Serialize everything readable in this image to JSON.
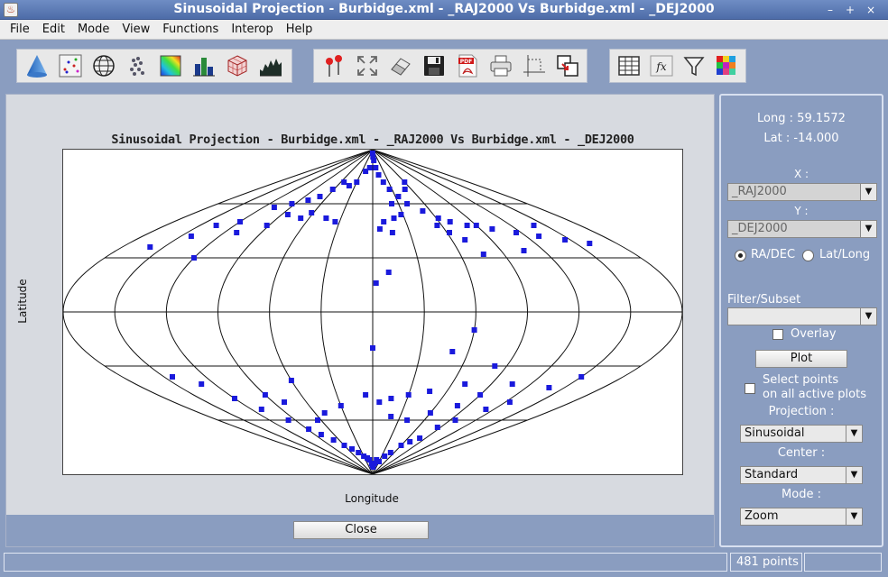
{
  "window": {
    "title": "Sinusoidal Projection - Burbidge.xml - _RAJ2000   Vs  Burbidge.xml - _DEJ2000",
    "controls": [
      "–",
      "+",
      "×"
    ]
  },
  "menu": [
    "File",
    "Edit",
    "Mode",
    "View",
    "Functions",
    "Interop",
    "Help"
  ],
  "toolbar": {
    "group1": [
      "cone-icon",
      "scatter-plot-icon",
      "globe-icon",
      "cluster-icon",
      "color-map-icon",
      "histogram-icon",
      "cube-icon",
      "area-chart-icon"
    ],
    "group2": [
      "pin-icon",
      "fit-zoom-icon",
      "eraser-icon",
      "save-icon",
      "pdf-icon",
      "print-icon",
      "crop-select-icon",
      "export-icon"
    ],
    "group3": [
      "table-icon",
      "function-icon",
      "filter-icon",
      "color-grid-icon"
    ],
    "pdf_badge": "PDF",
    "fx_label": "fx"
  },
  "plot": {
    "title": "Sinusoidal Projection - Burbidge.xml - _RAJ2000   Vs  Burbidge.xml - _DEJ2000",
    "xlabel": "Longitude",
    "ylabel": "Latitude",
    "close_label": "Close",
    "point_color": "#1a1adc",
    "chart_data": {
      "type": "scatter",
      "projection": "sinusoidal",
      "graticule": {
        "latitude_lines_deg": [
          -60,
          -30,
          0,
          30,
          60
        ],
        "meridians_deg": [
          0,
          30,
          60,
          90,
          120,
          150,
          180,
          210,
          240,
          270,
          300,
          330,
          360
        ]
      },
      "points": [
        [
          184,
          -86
        ],
        [
          178,
          -85
        ],
        [
          190,
          -84
        ],
        [
          174,
          -84
        ],
        [
          166,
          -82
        ],
        [
          196,
          -82
        ],
        [
          160,
          -81
        ],
        [
          210,
          -83
        ],
        [
          150,
          -80
        ],
        [
          140,
          -78
        ],
        [
          220,
          -80
        ],
        [
          130,
          -76
        ],
        [
          230,
          -78
        ],
        [
          120,
          -74
        ],
        [
          240,
          -74
        ],
        [
          110,
          -71
        ],
        [
          250,
          -72
        ],
        [
          100,
          -68
        ],
        [
          260,
          -70
        ],
        [
          92,
          -65
        ],
        [
          266,
          -64
        ],
        [
          82,
          -60
        ],
        [
          276,
          -60
        ],
        [
          70,
          -54
        ],
        [
          292,
          -54
        ],
        [
          60,
          -48
        ],
        [
          304,
          -50
        ],
        [
          50,
          -40
        ],
        [
          318,
          -42
        ],
        [
          36,
          -36
        ],
        [
          330,
          -36
        ],
        [
          200,
          -58
        ],
        [
          186,
          -50
        ],
        [
          196,
          -48
        ],
        [
          210,
          -46
        ],
        [
          226,
          -44
        ],
        [
          250,
          -40
        ],
        [
          262,
          -30
        ],
        [
          230,
          -22
        ],
        [
          240,
          -10
        ],
        [
          180,
          -20
        ],
        [
          174,
          -46
        ],
        [
          150,
          -52
        ],
        [
          130,
          -56
        ],
        [
          116,
          -60
        ],
        [
          100,
          -50
        ],
        [
          90,
          -46
        ],
        [
          120,
          -38
        ],
        [
          270,
          -46
        ],
        [
          286,
          -40
        ],
        [
          260,
          -52
        ],
        [
          240,
          -56
        ],
        [
          220,
          -60
        ],
        [
          178,
          88
        ],
        [
          182,
          86
        ],
        [
          186,
          84
        ],
        [
          190,
          80
        ],
        [
          194,
          76
        ],
        [
          200,
          72
        ],
        [
          206,
          68
        ],
        [
          170,
          80
        ],
        [
          160,
          78
        ],
        [
          150,
          72
        ],
        [
          140,
          70
        ],
        [
          126,
          72
        ],
        [
          118,
          68
        ],
        [
          110,
          64
        ],
        [
          100,
          62
        ],
        [
          220,
          60
        ],
        [
          232,
          56
        ],
        [
          242,
          52
        ],
        [
          250,
          50
        ],
        [
          262,
          48
        ],
        [
          270,
          48
        ],
        [
          280,
          46
        ],
        [
          296,
          44
        ],
        [
          310,
          42
        ],
        [
          326,
          40
        ],
        [
          340,
          38
        ],
        [
          86,
          60
        ],
        [
          72,
          58
        ],
        [
          60,
          50
        ],
        [
          44,
          48
        ],
        [
          38,
          42
        ],
        [
          20,
          36
        ],
        [
          200,
          52
        ],
        [
          190,
          50
        ],
        [
          186,
          46
        ],
        [
          146,
          50
        ],
        [
          136,
          52
        ],
        [
          118,
          55
        ],
        [
          112,
          52
        ],
        [
          96,
          54
        ],
        [
          88,
          48
        ],
        [
          70,
          44
        ],
        [
          230,
          68
        ],
        [
          240,
          72
        ],
        [
          250,
          40
        ],
        [
          256,
          32
        ],
        [
          196,
          44
        ],
        [
          190,
          22
        ],
        [
          182,
          16
        ],
        [
          60,
          30
        ],
        [
          202,
          60
        ],
        [
          208,
          54
        ],
        [
          214,
          64
        ],
        [
          236,
          48
        ],
        [
          242,
          44
        ],
        [
          286,
          34
        ],
        [
          320,
          48
        ]
      ],
      "cursor": {
        "long": "59.1572",
        "lat": "-14.000"
      }
    }
  },
  "side": {
    "long_label": "Long :",
    "long_value": "59.1572",
    "lat_label": "Lat   :",
    "lat_value": "-14.000",
    "x_label": "X :",
    "x_value": "_RAJ2000",
    "y_label": "Y :",
    "y_value": "_DEJ2000",
    "radio_radec": "RA/DEC",
    "radio_latlong": "Lat/Long",
    "filter_label": "Filter/Subset",
    "filter_value": "",
    "overlay_label": "Overlay",
    "plot_button": "Plot",
    "select_points_line1": "Select points",
    "select_points_line2": "on all active plots",
    "projection_label": "Projection :",
    "projection_value": "Sinusoidal",
    "center_label": "Center :",
    "center_value": "Standard",
    "mode_label": "Mode :",
    "mode_value": "Zoom"
  },
  "status": {
    "points": "481 points"
  }
}
